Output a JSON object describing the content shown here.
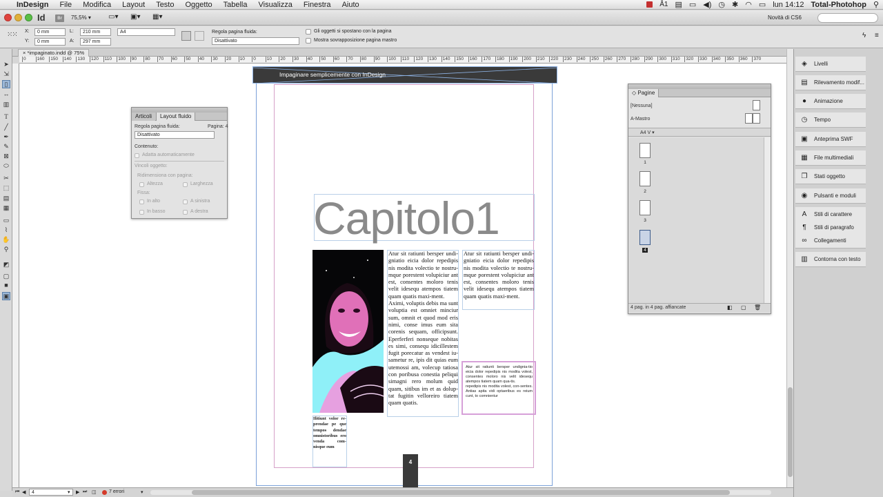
{
  "menubar": {
    "apple": "",
    "app": "InDesign",
    "items": [
      "File",
      "Modifica",
      "Layout",
      "Testo",
      "Oggetto",
      "Tabella",
      "Visualizza",
      "Finestra",
      "Aiuto"
    ],
    "status_ai": "1",
    "clock": "lun 14:12",
    "user": "Total-Photohop"
  },
  "appbar": {
    "app_icon": "Id",
    "bridge": "Br",
    "zoom": "75,5%",
    "novita": "Novità di CS6"
  },
  "control": {
    "x_label": "X:",
    "x_value": "0 mm",
    "y_label": "Y:",
    "y_value": "0 mm",
    "l_label": "L:",
    "l_value": "210 mm",
    "a_label": "A:",
    "a_value": "297 mm",
    "page_size": "A4",
    "fluid_rule_label": "Regola pagina fluida:",
    "fluid_rule_value": "Disattivato",
    "cb1": "Gli oggetti si spostano con la pagina",
    "cb2": "Mostra sovrapposizione pagina mastro"
  },
  "doc_tab": "*impaginato.indd @ 75%",
  "ruler_ticks": [
    "0",
    "160",
    "150",
    "140",
    "130",
    "120",
    "110",
    "100",
    "90",
    "80",
    "70",
    "60",
    "50",
    "40",
    "30",
    "20",
    "10",
    "0",
    "10",
    "20",
    "30",
    "40",
    "50",
    "60",
    "70",
    "80",
    "90",
    "100",
    "110",
    "120",
    "130",
    "140",
    "150",
    "160",
    "170",
    "180",
    "190",
    "200",
    "210",
    "220",
    "230",
    "240",
    "250",
    "260",
    "270",
    "280",
    "290",
    "300",
    "310",
    "320",
    "330",
    "340",
    "350",
    "360",
    "370"
  ],
  "layout_panel": {
    "tab1": "Articoli",
    "tab2": "Layout fluido",
    "rule_label": "Regola pagina fluida:",
    "page_label": "Pagina: 4",
    "rule_value": "Disattivato",
    "content_label": "Contenuto:",
    "auto_fit": "Adatta automaticamente",
    "constraints_label": "Vincoli oggetto:",
    "resize_label": "Ridimensiona con pagina:",
    "height": "Altezza",
    "width": "Larghezza",
    "fixed_label": "Fissa:",
    "top": "In alto",
    "left": "A sinistra",
    "bottom": "In basso",
    "right": "A destra"
  },
  "document": {
    "header_banner": "Impaginare semplicemente con InDesign",
    "chapter_title": "Capitolo1",
    "col1_text": "Atur sit ratiunti bersper undi-gniatio eicia dolor repedipis nis modita volectio te nostru-mque porestent volupiciur ant est, consentes moloro tenis velit idesequ atempos tiatem quam quatis maxi-ment.\nAximi, voluptis debis ma sunt voluptia est omniet minciur sum, omnit et quod mod eris nimi, conse imus eum sita corenis sequam, officipsunt. Eperferferi nonseque nobitas es simi, consequ idicillestem fugit porecatur as vendest iu-sametur re, ipis dit quias eum utemossi am, volecup tatiosa con poribusa conestia peliqui simagni rero molum quid quam, sitibus im et as dolup-tat fugitin velloreiro tiatem quam quatis.",
    "col2_text": "Atur sit ratiunti bersper undi-gniatio eicia dolor repedipis nis modita volectio te nostru-mque porestent volupiciur ant est, consentes moloro tenis velit idesequ atempos tiatem quam quatis maxi-ment.",
    "small_box_text": "Atur sit ratiunti bersper undignia-tio eicia dolor repedipis nis modita volest, consentes moloro nis velit idesequ atempos tiatem quam qua-tis.\nrepedipis nis modita volest, con-sentes. Antias apita vidi optaeribus es reium cunt, to comnientur",
    "caption_text": "Ilitiunt volor re-prendae pe que tempos dendae omnistoribus ero venda com-nisque eum",
    "page_number": "4"
  },
  "pages_panel": {
    "title": "Pagine",
    "none_master": "[Nessuna]",
    "a_master": "A-Mastro",
    "size": "A4 V",
    "pages": [
      "1",
      "2",
      "3",
      "4"
    ],
    "footer": "4 pag. in 4 pag. affiancate"
  },
  "right_dock": [
    {
      "label": "Livelli",
      "icon": "layers-icon",
      "glyph": "◈"
    },
    {
      "label": "Rilevamento modif...",
      "icon": "track-changes-icon",
      "glyph": "▤"
    },
    {
      "label": "Animazione",
      "icon": "animation-icon",
      "glyph": "●"
    },
    {
      "label": "Tempo",
      "icon": "timing-icon",
      "glyph": "◷"
    },
    {
      "label": "Anteprima SWF",
      "icon": "swf-preview-icon",
      "glyph": "▣"
    },
    {
      "label": "File multimediali",
      "icon": "media-icon",
      "glyph": "▦"
    },
    {
      "label": "Stati oggetto",
      "icon": "object-states-icon",
      "glyph": "❐"
    },
    {
      "label": "Pulsanti e moduli",
      "icon": "buttons-forms-icon",
      "glyph": "◉"
    },
    {
      "label": "Stili di carattere",
      "icon": "char-styles-icon",
      "glyph": "A"
    },
    {
      "label": "Stili di paragrafo",
      "icon": "para-styles-icon",
      "glyph": "¶"
    },
    {
      "label": "Collegamenti",
      "icon": "links-icon",
      "glyph": "∞"
    },
    {
      "label": "Contorna con testo",
      "icon": "text-wrap-icon",
      "glyph": "▥"
    }
  ],
  "status": {
    "page": "4",
    "errors": "7 errori"
  },
  "colors": {
    "banner": "#3a3a3a",
    "margin_pink": "#d6a0c8",
    "frame_blue": "#8fb4e6",
    "title_gray": "#8a8a8a"
  }
}
